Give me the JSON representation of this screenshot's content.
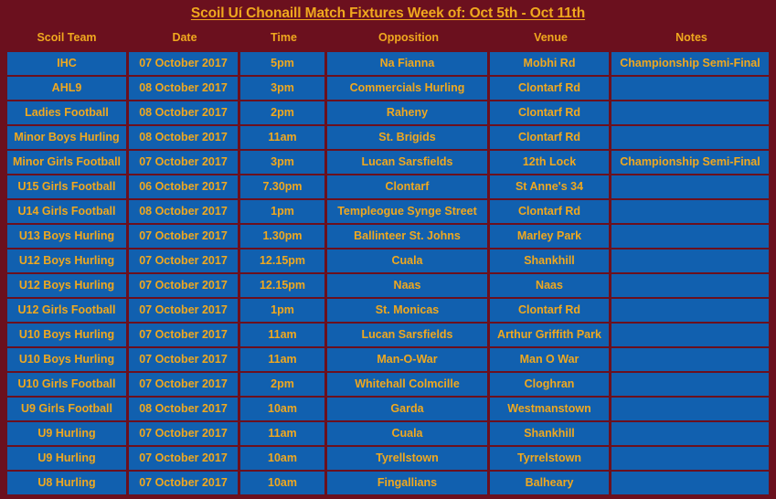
{
  "header": {
    "title": "Scoil Uí Chonaill Match Fixtures Week of: Oct 5th - Oct 11th"
  },
  "colors": {
    "background": "#6b101e",
    "cell": "#1160af",
    "text": "#f0a81e"
  },
  "table": {
    "columns": [
      {
        "key": "team",
        "label": "Scoil Team"
      },
      {
        "key": "date",
        "label": "Date"
      },
      {
        "key": "time",
        "label": "Time"
      },
      {
        "key": "opposition",
        "label": "Opposition"
      },
      {
        "key": "venue",
        "label": "Venue"
      },
      {
        "key": "notes",
        "label": "Notes"
      }
    ],
    "rows": [
      {
        "team": "IHC",
        "date": "07 October 2017",
        "time": "5pm",
        "opposition": "Na Fianna",
        "venue": "Mobhi Rd",
        "notes": "Championship Semi-Final"
      },
      {
        "team": "AHL9",
        "date": "08 October 2017",
        "time": "3pm",
        "opposition": "Commercials Hurling",
        "venue": "Clontarf Rd",
        "notes": ""
      },
      {
        "team": "Ladies Football",
        "date": "08 October 2017",
        "time": "2pm",
        "opposition": "Raheny",
        "venue": "Clontarf Rd",
        "notes": ""
      },
      {
        "team": "Minor Boys Hurling",
        "date": "08 October 2017",
        "time": "11am",
        "opposition": "St. Brigids",
        "venue": "Clontarf Rd",
        "notes": ""
      },
      {
        "team": "Minor Girls Football",
        "date": "07 October 2017",
        "time": "3pm",
        "opposition": "Lucan Sarsfields",
        "venue": "12th Lock",
        "notes": "Championship Semi-Final"
      },
      {
        "team": "U15 Girls Football",
        "date": "06 October 2017",
        "time": "7.30pm",
        "opposition": "Clontarf",
        "venue": "St Anne's 34",
        "notes": ""
      },
      {
        "team": "U14 Girls Football",
        "date": "08 October 2017",
        "time": "1pm",
        "opposition": "Templeogue Synge Street",
        "venue": "Clontarf Rd",
        "notes": ""
      },
      {
        "team": "U13 Boys Hurling",
        "date": "07 October 2017",
        "time": "1.30pm",
        "opposition": "Ballinteer St. Johns",
        "venue": "Marley Park",
        "notes": ""
      },
      {
        "team": "U12 Boys Hurling",
        "date": "07 October 2017",
        "time": "12.15pm",
        "opposition": "Cuala",
        "venue": "Shankhill",
        "notes": ""
      },
      {
        "team": "U12 Boys Hurling",
        "date": "07 October 2017",
        "time": "12.15pm",
        "opposition": "Naas",
        "venue": "Naas",
        "notes": ""
      },
      {
        "team": "U12 Girls Football",
        "date": "07 October 2017",
        "time": "1pm",
        "opposition": "St. Monicas",
        "venue": "Clontarf Rd",
        "notes": ""
      },
      {
        "team": "U10 Boys Hurling",
        "date": "07 October 2017",
        "time": "11am",
        "opposition": "Lucan Sarsfields",
        "venue": "Arthur Griffith Park",
        "notes": ""
      },
      {
        "team": "U10 Boys Hurling",
        "date": "07 October 2017",
        "time": "11am",
        "opposition": "Man-O-War",
        "venue": "Man O War",
        "notes": ""
      },
      {
        "team": "U10 Girls Football",
        "date": "07 October 2017",
        "time": "2pm",
        "opposition": "Whitehall Colmcille",
        "venue": "Cloghran",
        "notes": ""
      },
      {
        "team": "U9 Girls Football",
        "date": "08 October 2017",
        "time": "10am",
        "opposition": "Garda",
        "venue": "Westmanstown",
        "notes": ""
      },
      {
        "team": "U9 Hurling",
        "date": "07 October 2017",
        "time": "11am",
        "opposition": "Cuala",
        "venue": "Shankhill",
        "notes": ""
      },
      {
        "team": "U9 Hurling",
        "date": "07 October 2017",
        "time": "10am",
        "opposition": "Tyrellstown",
        "venue": "Tyrrelstown",
        "notes": ""
      },
      {
        "team": "U8 Hurling",
        "date": "07 October 2017",
        "time": "10am",
        "opposition": "Fingallians",
        "venue": "Balheary",
        "notes": ""
      }
    ]
  }
}
